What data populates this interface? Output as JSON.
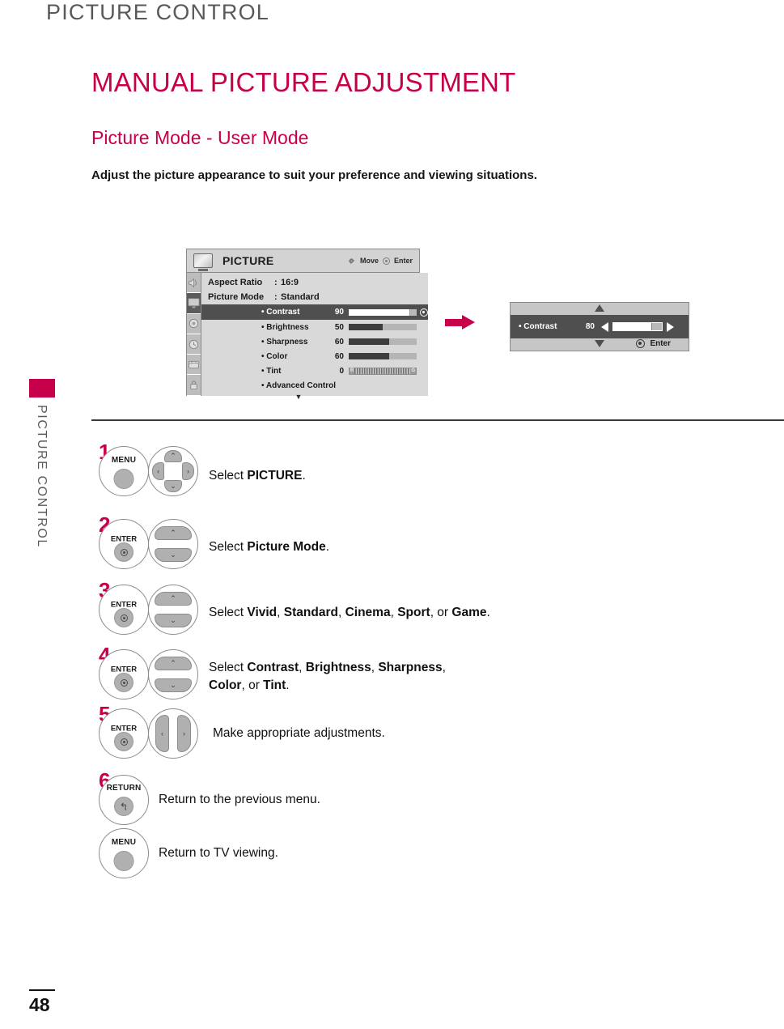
{
  "running_head": "PICTURE CONTROL",
  "side_tab": {
    "label": "PICTURE CONTROL",
    "color": "#c8004b"
  },
  "headings": {
    "h1": "MANUAL PICTURE ADJUSTMENT",
    "h2": "Picture Mode - User Mode",
    "lead": "Adjust the picture appearance to suit your preference and viewing situations."
  },
  "osd_menu": {
    "title": "PICTURE",
    "hint_move": "Move",
    "hint_enter": "Enter",
    "icons": [
      {
        "name": "audio-icon",
        "active": false
      },
      {
        "name": "picture-icon",
        "active": true
      },
      {
        "name": "setup-icon",
        "active": false
      },
      {
        "name": "time-icon",
        "active": false
      },
      {
        "name": "option-icon",
        "active": false
      },
      {
        "name": "lock-icon",
        "active": false
      }
    ],
    "rows": [
      {
        "label": "Aspect Ratio",
        "colon": ":",
        "value": "16:9"
      },
      {
        "label": "Picture Mode",
        "colon": ":",
        "value": "Standard"
      }
    ],
    "items": [
      {
        "name": "• Contrast",
        "value": "90",
        "percent": 90,
        "highlight": true,
        "type": "bar"
      },
      {
        "name": "• Brightness",
        "value": "50",
        "percent": 50,
        "highlight": false,
        "type": "bar"
      },
      {
        "name": "• Sharpness",
        "value": "60",
        "percent": 60,
        "highlight": false,
        "type": "bar"
      },
      {
        "name": "• Color",
        "value": "60",
        "percent": 60,
        "highlight": false,
        "type": "bar"
      },
      {
        "name": "• Tint",
        "value": "0",
        "percent": 50,
        "highlight": false,
        "type": "tint",
        "left_label": "R",
        "right_label": "G"
      },
      {
        "name": "• Advanced Control",
        "value": "",
        "percent": 0,
        "highlight": false,
        "type": "none"
      }
    ],
    "more_caret": "▼"
  },
  "arrow": {
    "name": "right-arrow",
    "color": "#c8004b"
  },
  "osd_popup": {
    "item_name": "• Contrast",
    "value": "80",
    "percent": 80,
    "enter_label": "Enter",
    "caret_up": "▲",
    "caret_down": "▼"
  },
  "steps": [
    {
      "num": "1",
      "button": {
        "label": "MENU",
        "type": "plain"
      },
      "pad": "four-way",
      "text_parts": [
        {
          "t": "Select ",
          "bold": false
        },
        {
          "t": "PICTURE",
          "bold": true
        },
        {
          "t": ".",
          "bold": false
        }
      ]
    },
    {
      "num": "2",
      "button": {
        "label": "ENTER",
        "type": "enter"
      },
      "pad": "up-down",
      "text_parts": [
        {
          "t": "Select ",
          "bold": false
        },
        {
          "t": "Picture Mode",
          "bold": true
        },
        {
          "t": ".",
          "bold": false
        }
      ]
    },
    {
      "num": "3",
      "button": {
        "label": "ENTER",
        "type": "enter"
      },
      "pad": "up-down",
      "text_parts": [
        {
          "t": "Select ",
          "bold": false
        },
        {
          "t": "Vivid",
          "bold": true
        },
        {
          "t": ", ",
          "bold": false
        },
        {
          "t": "Standard",
          "bold": true
        },
        {
          "t": ", ",
          "bold": false
        },
        {
          "t": "Cinema",
          "bold": true
        },
        {
          "t": ", ",
          "bold": false
        },
        {
          "t": "Sport",
          "bold": true
        },
        {
          "t": ", or ",
          "bold": false
        },
        {
          "t": "Game",
          "bold": true
        },
        {
          "t": ".",
          "bold": false
        }
      ]
    },
    {
      "num": "4",
      "button": {
        "label": "ENTER",
        "type": "enter"
      },
      "pad": "up-down",
      "text_parts": [
        {
          "t": "Select ",
          "bold": false
        },
        {
          "t": "Contrast",
          "bold": true
        },
        {
          "t": ", ",
          "bold": false
        },
        {
          "t": "Brightness",
          "bold": true
        },
        {
          "t": ", ",
          "bold": false
        },
        {
          "t": "Sharpness",
          "bold": true
        },
        {
          "t": ",",
          "bold": false
        },
        {
          "t": "\n",
          "bold": false
        },
        {
          "t": "Color",
          "bold": true
        },
        {
          "t": ", or ",
          "bold": false
        },
        {
          "t": "Tint",
          "bold": true
        },
        {
          "t": ".",
          "bold": false
        }
      ]
    },
    {
      "num": "5",
      "button": {
        "label": "ENTER",
        "type": "enter"
      },
      "pad": "left-right",
      "text_parts": [
        {
          "t": "Make appropriate adjustments.",
          "bold": false
        }
      ]
    },
    {
      "num": "6",
      "button": {
        "label": "RETURN",
        "type": "return"
      },
      "pad": "none",
      "text_parts": [
        {
          "t": "Return to the previous menu.",
          "bold": false
        }
      ]
    },
    {
      "num": "",
      "button": {
        "label": "MENU",
        "type": "plain"
      },
      "pad": "none",
      "text_parts": [
        {
          "t": "Return to TV viewing.",
          "bold": false
        }
      ]
    }
  ],
  "footer": {
    "page_number": "48"
  }
}
